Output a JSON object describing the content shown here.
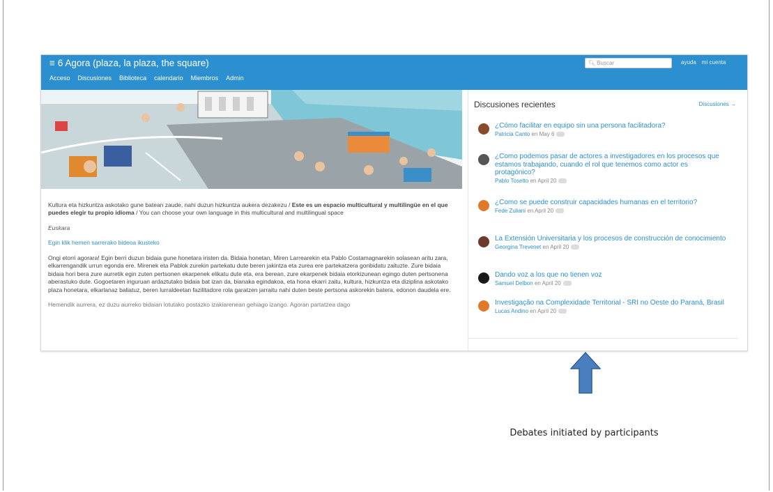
{
  "app": {
    "title": "6 Agora (plaza, la plaza, the square)",
    "nav": [
      "Acceso",
      "Discusiones",
      "Biblioteca",
      "calendario",
      "Miembros",
      "Admin"
    ],
    "search_placeholder": "Buscar",
    "links": [
      "ayuda",
      "mi cuenta"
    ],
    "accent_color": "#2b8fd0"
  },
  "main": {
    "intro_plain": "Kultura eta hizkuntza askotako gune batean zaude, nahi duzun hizkuntza aukera dezakezu / ",
    "intro_bold": "Este es un espacio multicultural y multilingüe en el que puedes elegir tu propio idioma",
    "intro_end": " / You can choose your own language in this multicultural and multilingual space",
    "language": "Euskara",
    "link": "Egin klik hemen sarrerako bideoa ikusteko",
    "paragraph": "Ongi etorri agorara! Egin berri duzun bidaia gune honetara iristen da. Bidaia honetan, Miren Larrearekin eta Pablo Costamagnarekin solasean aritu zara, elkarrengandik urrun egonda ere. Mirenek eta Pablok zurekin partekatu dute beren jakintza eta zurea ere partekatzera gonbidatu zaituzte. Zure bidaia bidaia hori bera zure aurretik egin zuten pertsonen ekarpenek elikatu dute eta, era berean, zure ekarpenek bidaia etorkizunean egingo duten pertsonena aberastuko dute. Gogoetaren inguruan ardaztutako bidaia bat izan da, bianaka egindakoa, eta hona ekarri zaitu, kultura, hizkuntza eta diziplina askotako plaza honetara, elkarlanaz baliatuz, beren lurraldeetan fazilitadore rola garatzen jarraitu nahi duten beste pertsona askorekin batera, edonon daudela ere.",
    "cut_line": "Hemendik aurrera, ez duzu aurreko bidaian lotutako postazko izakiarenean gehiago izango. Agoran partatzea dago"
  },
  "sidebar": {
    "heading": "Discusiones recientes",
    "more": "Discusiones →",
    "discussions": [
      {
        "title": "¿Cómo facilitar en equipo sin una persona facilitadora?",
        "author": "Patricia Canto",
        "on": "en",
        "date": "May 6",
        "avatar_color": "#8a4b2a"
      },
      {
        "title": "¿Como podemos pasar de actores a investigadores en los procesos que estamos trabajando, cuando el rol que tenemos como actor es protagónico?",
        "author": "Pablo Tosetto",
        "on": "en",
        "date": "April 20",
        "avatar_color": "#555555"
      },
      {
        "title": "¿Como se puede construir capacidades humanas en el territorio?",
        "author": "Fede Zuliani",
        "on": "en",
        "date": "April 20",
        "avatar_color": "#e07a2a"
      },
      {
        "title": "La Extensión Universitaria y los procesos de construcción de conocimiento",
        "author": "Georgina Trevenet",
        "on": "en",
        "date": "April 20",
        "avatar_color": "#6b3a2a"
      },
      {
        "title": "Dando voz a los que no tienen voz",
        "author": "Samuel Delbon",
        "on": "en",
        "date": "April 20",
        "avatar_color": "#1a1a1a"
      },
      {
        "title": "Investigação na Complexidade Territorial - SRI no Oeste do Paraná, Brasil",
        "author": "Lucas Andino",
        "on": "en",
        "date": "April 20",
        "avatar_color": "#e07a2a"
      }
    ]
  },
  "annotation": {
    "caption": "Debates initiated by participants",
    "arrow_color": "#4a7fbf"
  }
}
